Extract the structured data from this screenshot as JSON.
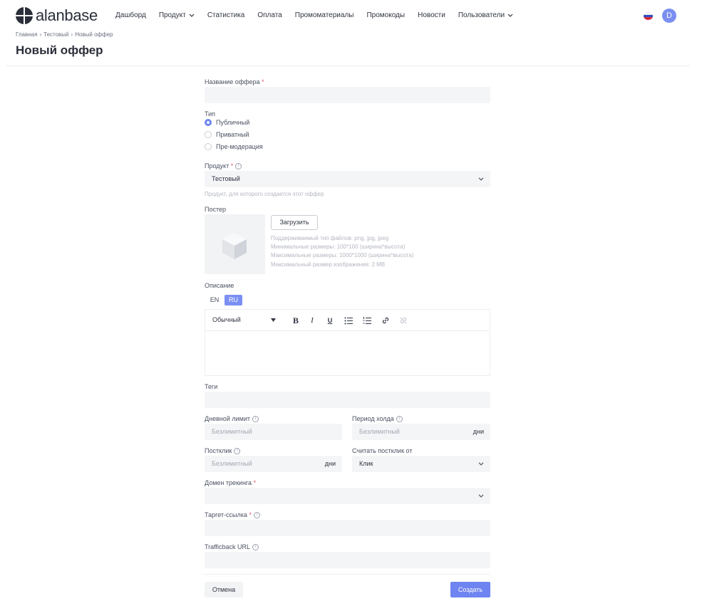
{
  "header": {
    "logo_text": "alanbase",
    "nav": [
      {
        "label": "Дашборд",
        "dropdown": false
      },
      {
        "label": "Продукт",
        "dropdown": true
      },
      {
        "label": "Статистика",
        "dropdown": false
      },
      {
        "label": "Оплата",
        "dropdown": false
      },
      {
        "label": "Промоматериалы",
        "dropdown": false
      },
      {
        "label": "Промокоды",
        "dropdown": false
      },
      {
        "label": "Новости",
        "dropdown": false
      },
      {
        "label": "Пользователи",
        "dropdown": true
      }
    ],
    "language_flag": "ru-flag-icon",
    "avatar_letter": "D"
  },
  "breadcrumb": [
    "Главная",
    "Тестовый",
    "Новый оффер"
  ],
  "page_title": "Новый оффер",
  "form": {
    "offer_name": {
      "label": "Название оффера",
      "required_mark": "*",
      "value": ""
    },
    "type": {
      "label": "Тип",
      "options": [
        "Публичный",
        "Приватный",
        "Пре-модерация"
      ],
      "selected": "Публичный"
    },
    "product": {
      "label": "Продукт",
      "required_mark": "*",
      "value": "Тестовый",
      "hint": "Продукт, для которого создается этот оффер"
    },
    "poster": {
      "label": "Постер",
      "upload_label": "Загрузить",
      "hints": [
        "Поддерживаемый тип файлов: png, jpg, jpeg",
        "Минимальные размеры: 100*100 (ширина*высота)",
        "Максимальные размеры: 1000*1000 (ширина*высота)",
        "Максимальный размер изображения: 2 MB"
      ]
    },
    "description": {
      "label": "Описание",
      "langs": [
        "EN",
        "RU"
      ],
      "active_lang": "RU",
      "format_value": "Обычный",
      "toolbar_icons": [
        "bold-icon",
        "italic-icon",
        "underline-icon",
        "bullet-list-icon",
        "ordered-list-icon",
        "link-icon",
        "unlink-icon"
      ]
    },
    "tags": {
      "label": "Теги",
      "value": ""
    },
    "daily_limit": {
      "label": "Дневной лимит",
      "placeholder": "Безлимитный"
    },
    "hold_period": {
      "label": "Период холда",
      "placeholder": "Безлимитный",
      "suffix": "дни"
    },
    "postclick": {
      "label": "Постклик",
      "placeholder": "Безлимитный",
      "suffix": "дни"
    },
    "postclick_from": {
      "label": "Считать постклик от",
      "value": "Клик"
    },
    "tracking_domain": {
      "label": "Домен трекинга",
      "required_mark": "*",
      "value": ""
    },
    "target_link": {
      "label": "Таргет-ссылка",
      "required_mark": "*",
      "value": ""
    },
    "trafficback": {
      "label": "Trafficback URL",
      "value": ""
    }
  },
  "actions": {
    "cancel_label": "Отмена",
    "create_label": "Создать"
  },
  "colors": {
    "accent": "#6e84f0",
    "required": "#e0566a",
    "field_bg": "#f4f5f7"
  }
}
